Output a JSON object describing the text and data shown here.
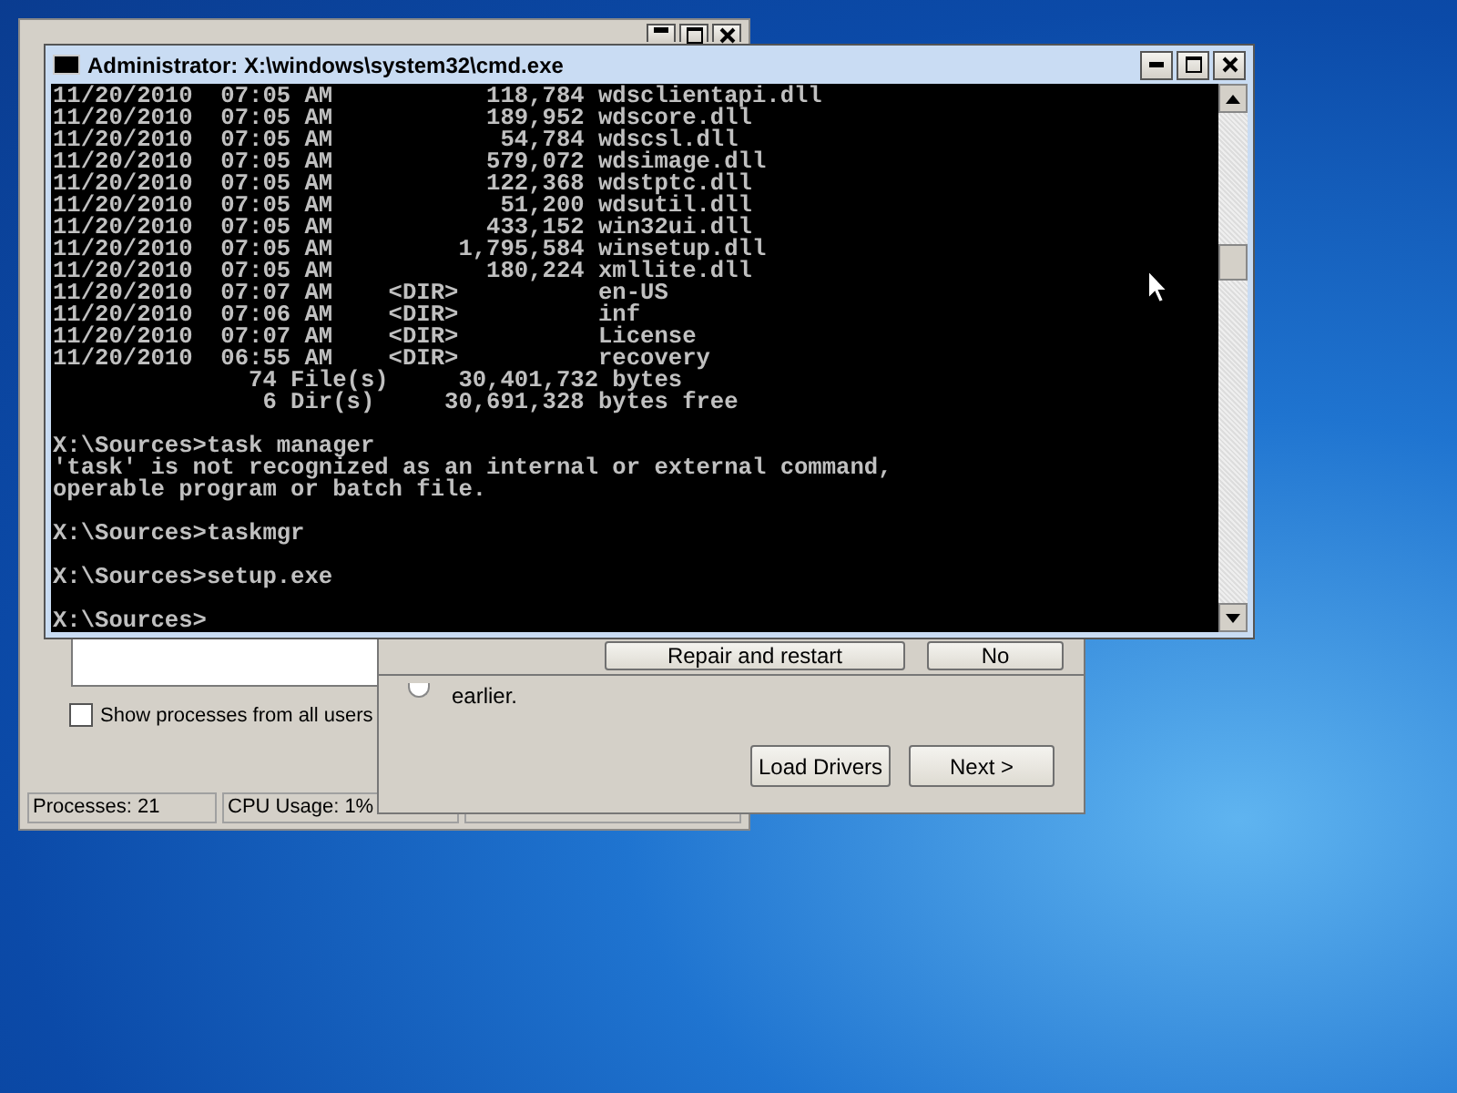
{
  "task_manager": {
    "show_all_users": {
      "label": "Show processes from all users",
      "checked": false
    },
    "status_bar": [
      "Processes: 21",
      "CPU Usage: 1%"
    ]
  },
  "setup_dialog": {
    "top_buttons": [
      "Repair and restart",
      "No"
    ],
    "option": {
      "text": "earlier.",
      "selected": false
    },
    "buttons": [
      "Load Drivers",
      "Next >"
    ]
  },
  "cmd": {
    "title": "Administrator: X:\\windows\\system32\\cmd.exe",
    "blocks": [
      [
        "11/20/2010  07:05 AM           118,784 wdsclientapi.dll",
        "11/20/2010  07:05 AM           189,952 wdscore.dll",
        "11/20/2010  07:05 AM            54,784 wdscsl.dll",
        "11/20/2010  07:05 AM           579,072 wdsimage.dll",
        "11/20/2010  07:05 AM           122,368 wdstptc.dll",
        "11/20/2010  07:05 AM            51,200 wdsutil.dll",
        "11/20/2010  07:05 AM           433,152 win32ui.dll",
        "11/20/2010  07:05 AM         1,795,584 winsetup.dll",
        "11/20/2010  07:05 AM           180,224 xmllite.dll",
        "11/20/2010  07:07 AM    <DIR>          en-US",
        "11/20/2010  07:06 AM    <DIR>          inf",
        "11/20/2010  07:07 AM    <DIR>          License",
        "11/20/2010  06:55 AM    <DIR>          recovery",
        "              74 File(s)     30,401,732 bytes",
        "               6 Dir(s)     30,691,328 bytes free"
      ],
      [
        "X:\\Sources>task manager",
        "'task' is not recognized as an internal or external command,",
        "operable program or batch file."
      ],
      [
        "X:\\Sources>taskmgr"
      ],
      [
        "X:\\Sources>setup.exe"
      ],
      [
        "X:\\Sources>"
      ]
    ]
  }
}
